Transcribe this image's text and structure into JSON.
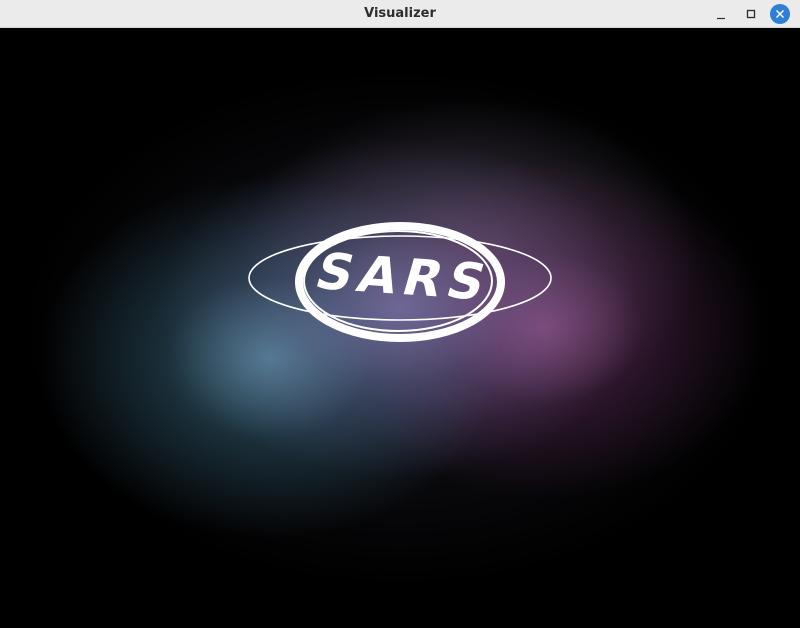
{
  "window": {
    "title": "Visualizer",
    "close_button_color": "#2f7fd6"
  },
  "scene": {
    "logo_text": "SARS",
    "glow_colors": {
      "cyan": "#69aac3",
      "magenta": "#9b508c",
      "lavender": "#9687c8"
    },
    "icons": [
      "minimize-icon",
      "maximize-icon",
      "close-icon"
    ]
  }
}
